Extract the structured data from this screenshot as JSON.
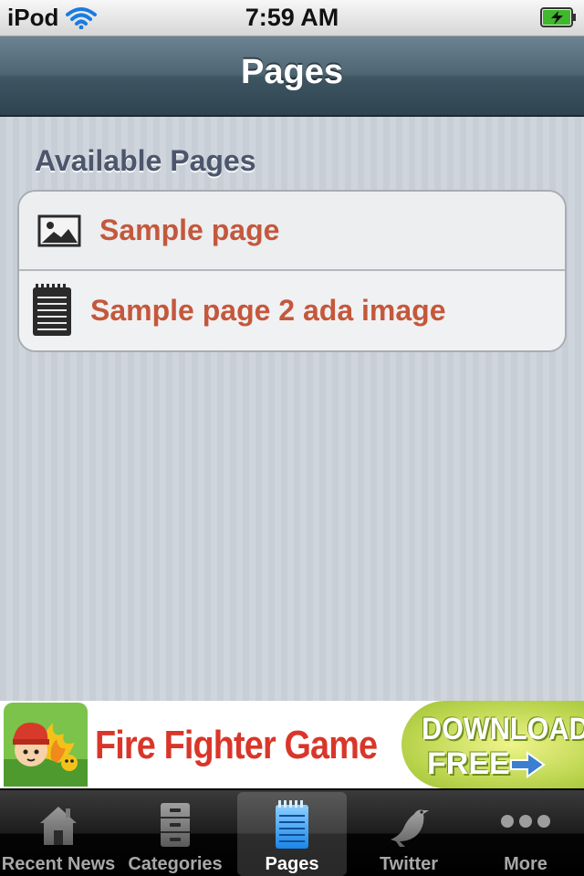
{
  "status_bar": {
    "carrier": "iPod",
    "time": "7:59 AM",
    "wifi_icon": "wifi-icon",
    "battery_icon": "battery-charging-icon"
  },
  "nav": {
    "title": "Pages"
  },
  "section": {
    "header": "Available Pages",
    "rows": [
      {
        "label": "Sample page",
        "icon": "image-icon"
      },
      {
        "label": "Sample page 2 ada image",
        "icon": "notepad-icon"
      }
    ]
  },
  "ad": {
    "title": "Fire Fighter Game",
    "cta_line1": "DOWNLOAD",
    "cta_line2": "FREE"
  },
  "tabbar": {
    "selected": "Pages",
    "tabs": [
      {
        "label": "Recent News",
        "icon": "house-icon"
      },
      {
        "label": "Categories",
        "icon": "file-cabinet-icon"
      },
      {
        "label": "Pages",
        "icon": "notepad-icon"
      },
      {
        "label": "Twitter",
        "icon": "bird-icon"
      },
      {
        "label": "More",
        "icon": "more-dots-icon"
      }
    ]
  },
  "colors": {
    "row_text": "#c4583c",
    "section_header": "#4c566c",
    "nav_bar": "#3e5562",
    "selected_tab_icon": "#36a3f7"
  }
}
